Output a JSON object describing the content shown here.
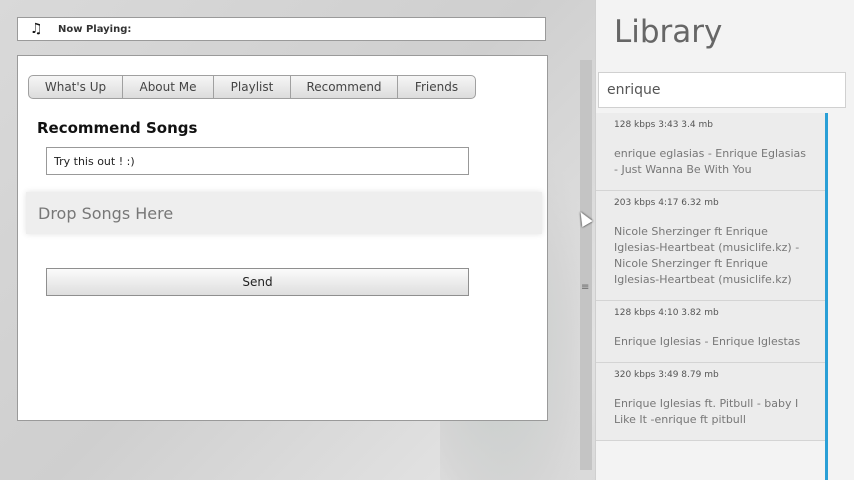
{
  "now_playing": {
    "icon": "music-note-icon",
    "label": "Now Playing:"
  },
  "tabs": [
    {
      "label": "What's Up"
    },
    {
      "label": "About Me"
    },
    {
      "label": "Playlist"
    },
    {
      "label": "Recommend"
    },
    {
      "label": "Friends"
    }
  ],
  "recommend": {
    "heading": "Recommend Songs",
    "message_value": "Try this out ! :)",
    "drop_zone": "Drop Songs Here",
    "send_label": "Send"
  },
  "splitter": {
    "grip": "≡"
  },
  "library": {
    "title": "Library",
    "search_value": "enrique",
    "results": [
      {
        "meta": "128 kbps 3:43 3.4 mb",
        "title": "enrique eglasias - Enrique Eglasias - Just Wanna Be With You"
      },
      {
        "meta": "203 kbps 4:17 6.32 mb",
        "title": "Nicole Sherzinger ft Enrique Iglesias-Heartbeat (musiclife.kz) - Nicole Sherzinger ft Enrique Iglesias-Heartbeat (musiclife.kz)"
      },
      {
        "meta": "128 kbps 4:10 3.82 mb",
        "title": "Enrique Iglesias - Enrique Iglestas"
      },
      {
        "meta": "320 kbps 3:49 8.79 mb",
        "title": "Enrique Iglesias ft. Pitbull - baby I Like It -enrique ft pitbull"
      }
    ]
  },
  "colors": {
    "accent": "#2a9fd6"
  }
}
